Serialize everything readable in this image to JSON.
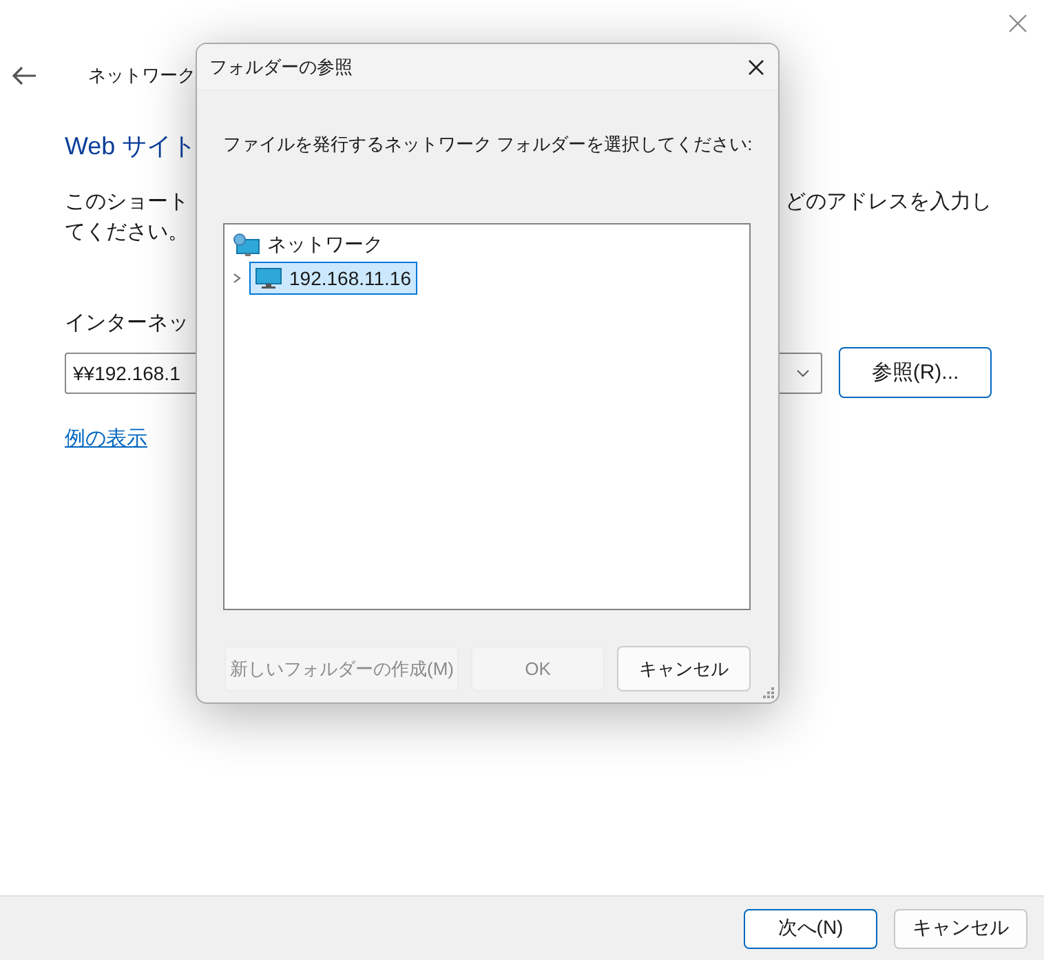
{
  "wizard": {
    "title": "ネットワーク",
    "heading": "Web サイト",
    "description_left": [
      "このショート",
      "てください。"
    ],
    "description_right": "どのアドレスを入力し",
    "address_label": "インターネッ",
    "address_value": "¥¥192.168.1",
    "browse_button": "参照(R)...",
    "example_link": "例の表示"
  },
  "dialog": {
    "title": "フォルダーの参照",
    "instruction": "ファイルを発行するネットワーク フォルダーを選択してください:",
    "tree": [
      {
        "label": "ネットワーク",
        "kind": "network",
        "selected": false,
        "children": [
          {
            "label": "192.168.11.16",
            "kind": "computer",
            "expanded": false,
            "selected": true
          }
        ]
      }
    ],
    "buttons": [
      {
        "label": "新しいフォルダーの作成(M)",
        "disabled": true
      },
      {
        "label": "OK",
        "disabled": true
      },
      {
        "label": "キャンセル",
        "disabled": false
      }
    ]
  },
  "footer": {
    "buttons": [
      {
        "label": "次へ(N)",
        "default": true
      },
      {
        "label": "キャンセル",
        "default": false
      }
    ]
  }
}
